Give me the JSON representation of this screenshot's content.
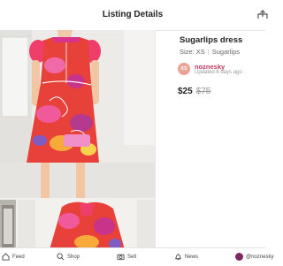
{
  "header": {
    "title": "Listing Details",
    "share_icon": "share-icon"
  },
  "listing": {
    "title": "Sugarlips dress",
    "size_label": "Size: XS",
    "brand": "Sugarlips",
    "seller": {
      "avatar_text": "XS",
      "name": "noznesky",
      "updated": "Updated 6 days ago"
    },
    "price": "$25",
    "original_price": "$75"
  },
  "tabs": [
    {
      "label": "Feed",
      "icon": "home-icon"
    },
    {
      "label": "Shop",
      "icon": "search-icon"
    },
    {
      "label": "Sell",
      "icon": "camera-icon"
    },
    {
      "label": "News",
      "icon": "bell-icon"
    },
    {
      "label": "@noznesky",
      "icon": "profile-avatar"
    }
  ],
  "colors": {
    "accent": "#c03a64",
    "dress_primary": "#e8413a",
    "dress_pink": "#f0508f"
  }
}
